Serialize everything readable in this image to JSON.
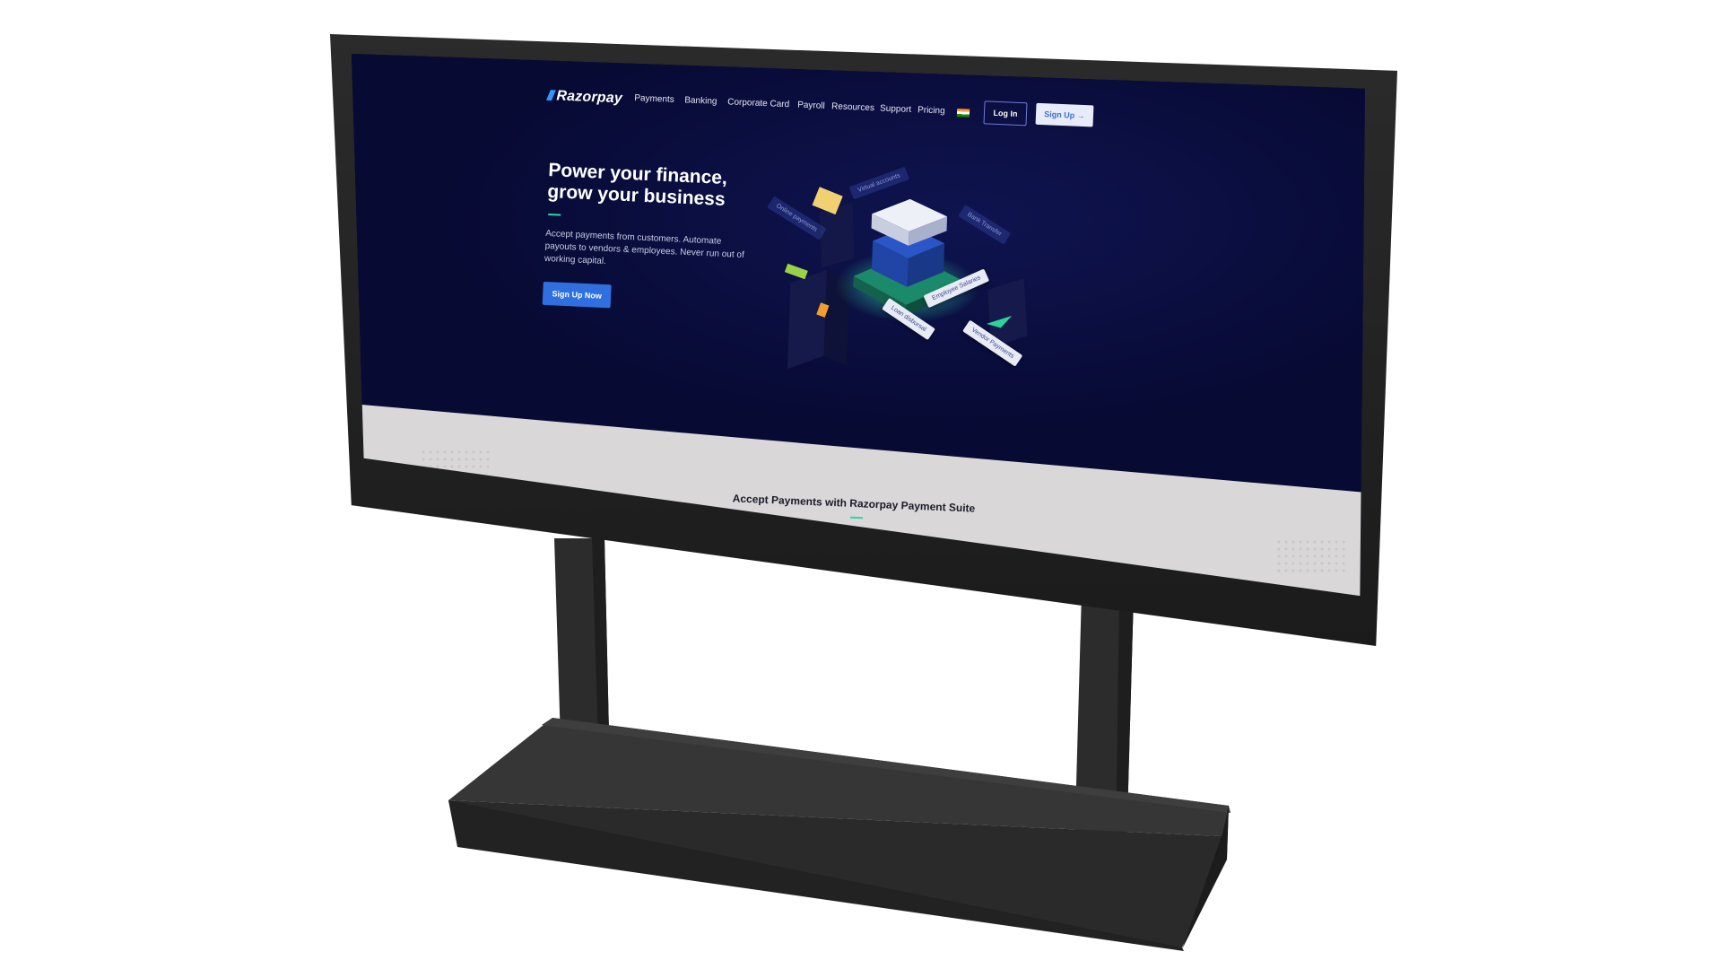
{
  "site": {
    "brand": "Razorpay",
    "nav": {
      "items": [
        "Payments",
        "Banking",
        "Corporate Card",
        "Payroll",
        "Resources",
        "Support",
        "Pricing"
      ],
      "login_label": "Log In",
      "signup_label": "Sign Up →"
    },
    "hero": {
      "title_line1": "Power your finance,",
      "title_line2": "grow your business",
      "subtitle": "Accept payments from customers. Automate payouts to vendors & employees. Never run out of working capital.",
      "cta_label": "Sign Up Now"
    },
    "illustration_tags": {
      "virtual_accounts": "Virtual accounts",
      "online_payments": "Online payments",
      "bank_transfer": "Bank Transfer",
      "employee_salaries": "Employee Salaries",
      "loan_disbursal": "Loan disbursal",
      "vendor_payments": "Vendor Payments"
    },
    "section_title": "Accept Payments with Razorpay Payment Suite"
  },
  "colors": {
    "hero_bg": "#070a33",
    "accent_blue": "#2f6fe0",
    "accent_green": "#2dd4a4",
    "light_bg": "#d9d7d8",
    "bezel": "#1f1f1f"
  }
}
